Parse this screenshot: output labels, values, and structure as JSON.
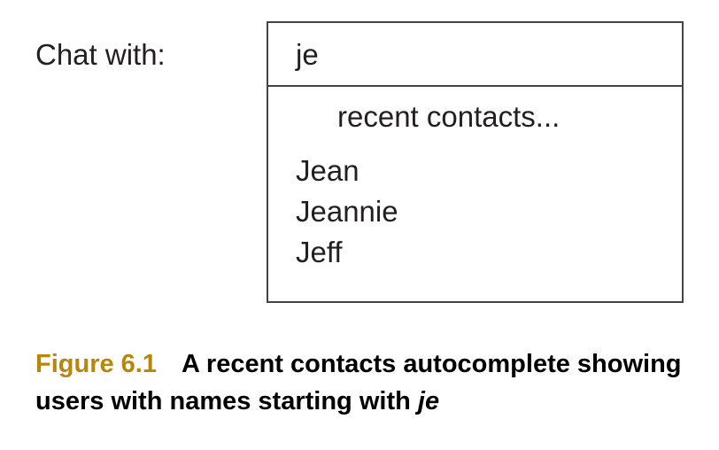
{
  "form": {
    "label": "Chat with:"
  },
  "autocomplete": {
    "input_value": "je",
    "header": "recent contacts...",
    "contacts": [
      {
        "name": "Jean"
      },
      {
        "name": "Jeannie"
      },
      {
        "name": "Jeff"
      }
    ]
  },
  "caption": {
    "number": "Figure 6.1",
    "text": "A recent contacts autocomplete showing users with names starting with",
    "emphasis": "je"
  },
  "colors": {
    "caption_number": "#b8860b",
    "border": "#444444",
    "text": "#231f20"
  }
}
